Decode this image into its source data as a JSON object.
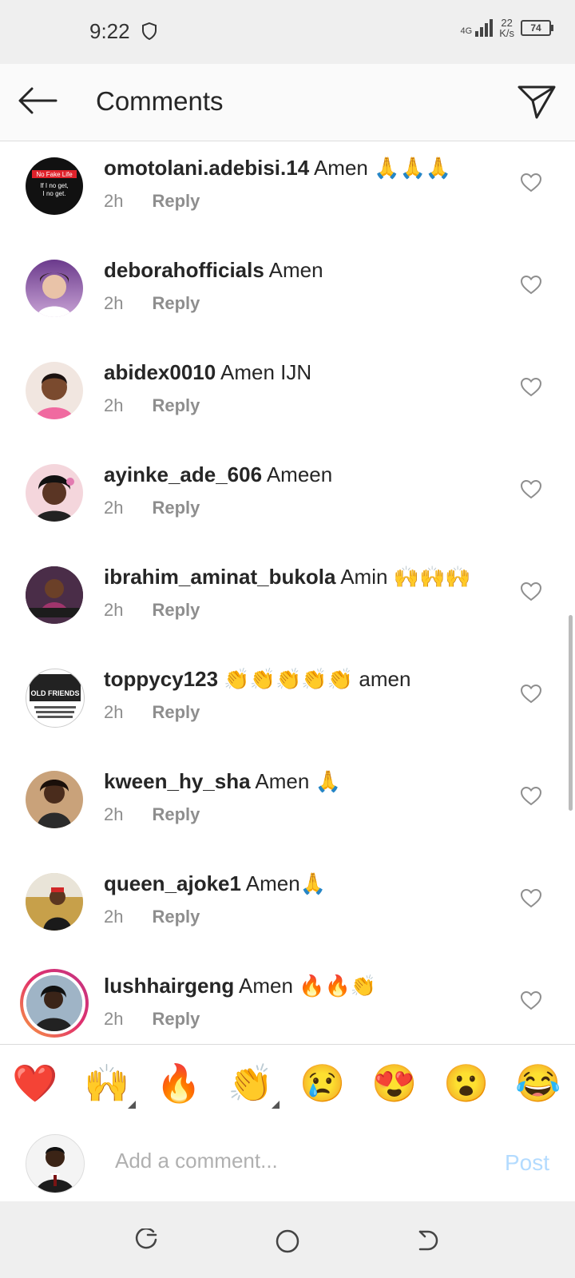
{
  "status_bar": {
    "time": "9:22",
    "network_type": "4G",
    "speed_value": "22",
    "speed_unit": "K/s",
    "battery": "74"
  },
  "header": {
    "title": "Comments"
  },
  "avatar_texts": {
    "fake_life_banner": "No Fake Life",
    "fake_life_line1": "If I no get,",
    "fake_life_line2": "I no get.",
    "old_friends": "OLD FRIENDS"
  },
  "comments": [
    {
      "username": "omotolani.adebisi.14",
      "text": "Amen 🙏🙏🙏",
      "time": "2h",
      "reply": "Reply"
    },
    {
      "username": "deborahofficials",
      "text": "Amen",
      "time": "2h",
      "reply": "Reply"
    },
    {
      "username": "abidex0010",
      "text": "Amen IJN",
      "time": "2h",
      "reply": "Reply"
    },
    {
      "username": "ayinke_ade_606",
      "text": "Ameen",
      "time": "2h",
      "reply": "Reply"
    },
    {
      "username": "ibrahim_aminat_bukola",
      "text": "Amin 🙌🙌🙌",
      "time": "2h",
      "reply": "Reply"
    },
    {
      "username": "toppycy123",
      "text": "👏👏👏👏👏 amen",
      "time": "2h",
      "reply": "Reply"
    },
    {
      "username": "kween_hy_sha",
      "text": "Amen 🙏",
      "time": "2h",
      "reply": "Reply"
    },
    {
      "username": "queen_ajoke1",
      "text": "Amen🙏",
      "time": "2h",
      "reply": "Reply"
    },
    {
      "username": "lushhairgeng",
      "text": "Amen 🔥🔥👏",
      "time": "2h",
      "reply": "Reply"
    }
  ],
  "reactions": [
    "❤️",
    "🙌",
    "🔥",
    "👏",
    "😢",
    "😍",
    "😮",
    "😂"
  ],
  "composer": {
    "placeholder": "Add a comment...",
    "post_label": "Post"
  },
  "colors": {
    "accent_post": "#b3dbff",
    "story_ring": "#e1306c"
  }
}
